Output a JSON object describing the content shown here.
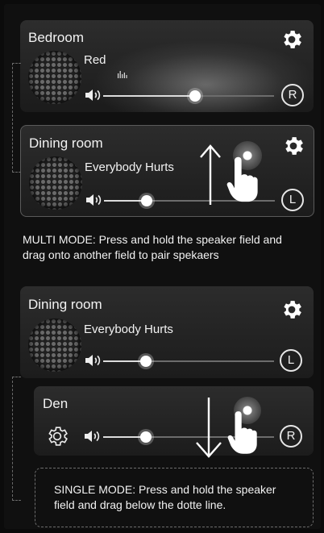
{
  "cards": {
    "bedroom": {
      "room": "Bedroom",
      "track": "Red",
      "channel": "R",
      "volume": 0.54
    },
    "dining_top": {
      "room": "Dining room",
      "track": "Everybody Hurts",
      "channel": "L",
      "volume": 0.25
    },
    "dining_bottom": {
      "room": "Dining room",
      "track": "Everybody Hurts",
      "channel": "L",
      "volume": 0.25
    },
    "den": {
      "room": "Den",
      "channel": "R",
      "volume": 0.25
    }
  },
  "instructions": {
    "multi": "MULTI MODE: Press and hold the speaker field and drag onto another field to pair spekaers",
    "single": "SINGLE MODE: Press and hold the speaker field and drag below the dotte line."
  },
  "icons": {
    "settings": "gear-icon",
    "volume": "speaker-volume-icon",
    "equalizer": "equalizer-icon",
    "album_art": "speaker-grille",
    "drag_up": "arrow-up-icon",
    "drag_down": "arrow-down-icon",
    "touch": "hand-pointer-icon"
  },
  "colors": {
    "background": "#101010",
    "card": "#262626",
    "accent": "#ffffff"
  }
}
